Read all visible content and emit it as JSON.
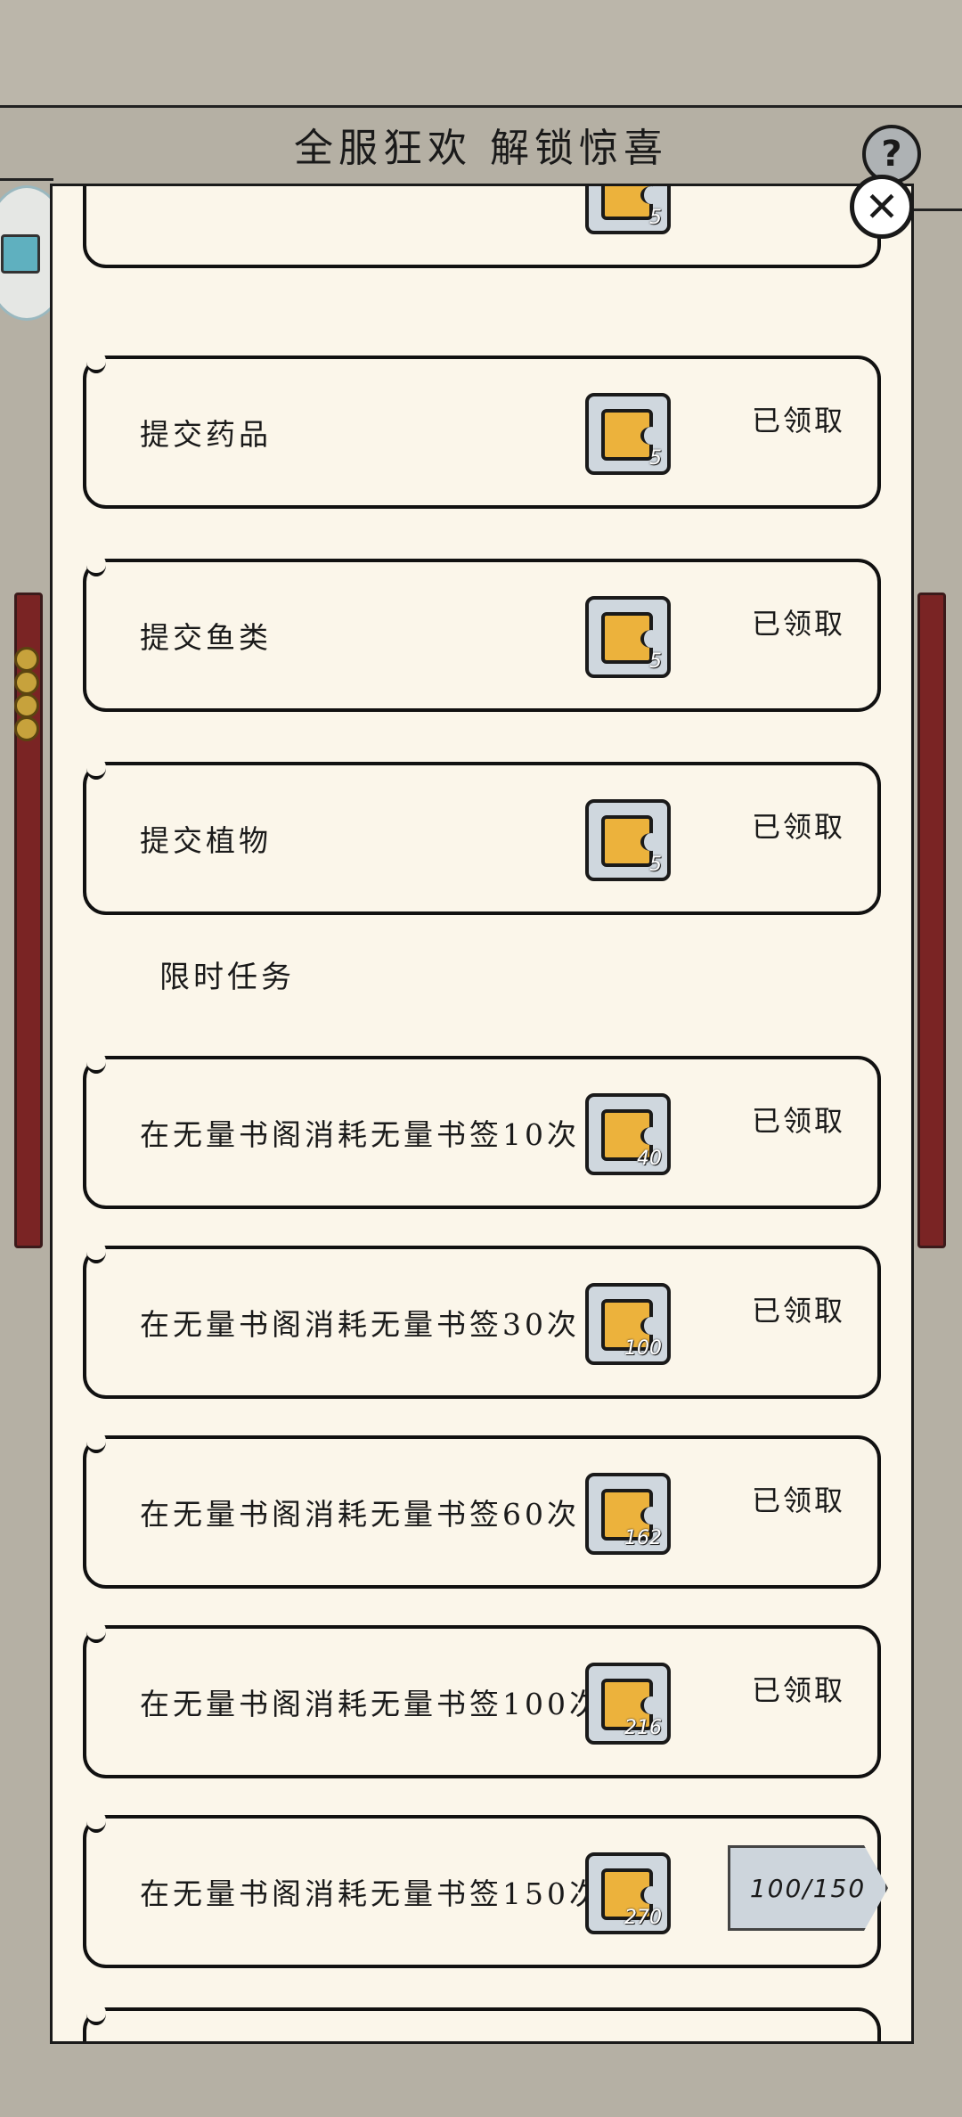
{
  "header": {
    "title": "全服狂欢 解锁惊喜",
    "help_icon": "?",
    "close_icon": "✕"
  },
  "tasks": [
    {
      "label": "提交药品",
      "reward": "5",
      "status": "已领取"
    },
    {
      "label": "提交鱼类",
      "reward": "5",
      "status": "已领取"
    },
    {
      "label": "提交植物",
      "reward": "5",
      "status": "已领取"
    }
  ],
  "partial_top": {
    "reward": "5"
  },
  "limited": {
    "title": "限时任务",
    "tasks": [
      {
        "label": "在无量书阁消耗无量书签10次",
        "reward": "40",
        "status": "已领取"
      },
      {
        "label": "在无量书阁消耗无量书签30次",
        "reward": "100",
        "status": "已领取"
      },
      {
        "label": "在无量书阁消耗无量书签60次",
        "reward": "162",
        "status": "已领取"
      },
      {
        "label": "在无量书阁消耗无量书签100次",
        "reward": "216",
        "status": "已领取"
      },
      {
        "label": "在无量书阁消耗无量书签150次",
        "reward": "270",
        "progress": "100/150"
      }
    ]
  }
}
